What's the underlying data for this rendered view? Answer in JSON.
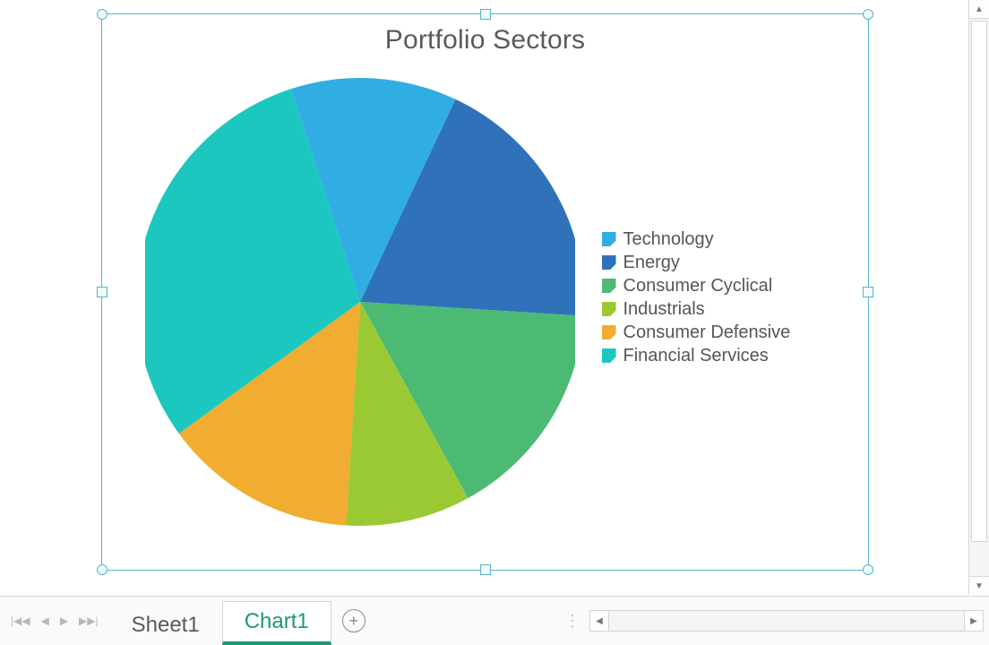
{
  "chart_data": {
    "type": "pie",
    "title": "Portfolio Sectors",
    "series": [
      {
        "name": "Technology",
        "value": 12,
        "color": "#30aee3"
      },
      {
        "name": "Energy",
        "value": 19,
        "color": "#2f72ba"
      },
      {
        "name": "Consumer Cyclical",
        "value": 16,
        "color": "#4dba74"
      },
      {
        "name": "Industrials",
        "value": 9,
        "color": "#9bc933"
      },
      {
        "name": "Consumer Defensive",
        "value": 14,
        "color": "#f0ad31"
      },
      {
        "name": "Financial Services",
        "value": 30,
        "color": "#1cc7c0"
      }
    ],
    "start_angle_deg": -18,
    "legend_position": "right"
  },
  "tabs": {
    "items": [
      {
        "label": "Sheet1",
        "active": false
      },
      {
        "label": "Chart1",
        "active": true
      }
    ]
  }
}
